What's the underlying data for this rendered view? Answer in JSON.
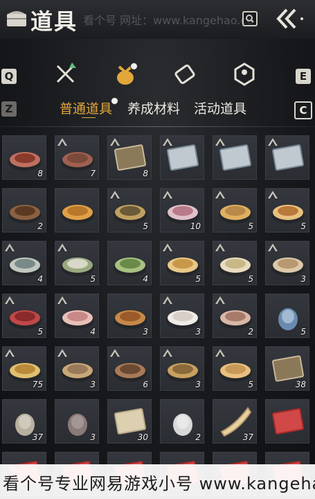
{
  "header": {
    "title": "道具",
    "watermark": "看个号 网址：www.kangehao.co",
    "icons": [
      "inventory-icon",
      "search-icon",
      "back-icon"
    ]
  },
  "keys": {
    "prev_tab": "Q",
    "next_tab": "E",
    "prev_subtab": "Z",
    "next_subtab": "C"
  },
  "category_tabs": [
    {
      "icon": "weapons-icon",
      "active": false,
      "badge": "up-arrow"
    },
    {
      "icon": "items-bag-icon",
      "active": true,
      "badge": "clock-dot"
    },
    {
      "icon": "scroll-icon",
      "active": false
    },
    {
      "icon": "gem-icon",
      "active": false
    }
  ],
  "subtabs": [
    {
      "label": "普通道具",
      "active": true
    },
    {
      "label": "养成材料",
      "active": false
    },
    {
      "label": "活动道具",
      "active": false
    }
  ],
  "items": [
    {
      "icon": "meat-icon",
      "qty": "8",
      "rank": false
    },
    {
      "icon": "sausage-plate-icon",
      "qty": "7",
      "rank": true
    },
    {
      "icon": "recipe-scroll-icon",
      "qty": "8",
      "rank": true
    },
    {
      "icon": "landscape-scroll-icon",
      "qty": "",
      "rank": true
    },
    {
      "icon": "landscape-scroll-icon",
      "qty": "",
      "rank": true
    },
    {
      "icon": "landscape-scroll-icon",
      "qty": "",
      "rank": true
    },
    {
      "icon": "eggs-icon",
      "qty": "2",
      "rank": false
    },
    {
      "icon": "buns-icon",
      "qty": "",
      "rank": false
    },
    {
      "icon": "mixed-dish-icon",
      "qty": "5",
      "rank": true
    },
    {
      "icon": "rice-dish-icon",
      "qty": "10",
      "rank": true
    },
    {
      "icon": "cake-icon",
      "qty": "5",
      "rank": true
    },
    {
      "icon": "soup-bowl-icon",
      "qty": "5",
      "rank": true
    },
    {
      "icon": "fish-soup-icon",
      "qty": "4",
      "rank": true
    },
    {
      "icon": "vegetable-soup-icon",
      "qty": "5",
      "rank": true
    },
    {
      "icon": "greens-plate-icon",
      "qty": "4",
      "rank": false
    },
    {
      "icon": "pancakes-icon",
      "qty": "5",
      "rank": true
    },
    {
      "icon": "noodle-bowl-icon",
      "qty": "5",
      "rank": true
    },
    {
      "icon": "porridge-bowl-icon",
      "qty": "3",
      "rank": true
    },
    {
      "icon": "braised-meat-icon",
      "qty": "5",
      "rank": true
    },
    {
      "icon": "sliced-meat-icon",
      "qty": "4",
      "rank": true
    },
    {
      "icon": "fried-chicken-icon",
      "qty": "3",
      "rank": false
    },
    {
      "icon": "dumplings-icon",
      "qty": "3",
      "rank": true
    },
    {
      "icon": "bean-soup-icon",
      "qty": "2",
      "rank": true
    },
    {
      "icon": "vase-icon",
      "qty": "5",
      "rank": false
    },
    {
      "icon": "fried-rice-icon",
      "qty": "75",
      "rank": true
    },
    {
      "icon": "seafood-plate-icon",
      "qty": "3",
      "rank": true
    },
    {
      "icon": "clay-pot-icon",
      "qty": "6",
      "rank": true
    },
    {
      "icon": "stew-bowl-icon",
      "qty": "3",
      "rank": true
    },
    {
      "icon": "pastry-icon",
      "qty": "5",
      "rank": true
    },
    {
      "icon": "letter-scroll-icon",
      "qty": "38",
      "rank": false
    },
    {
      "icon": "jar-icon",
      "qty": "37",
      "rank": false
    },
    {
      "icon": "pouch-icon",
      "qty": "3",
      "rank": false
    },
    {
      "icon": "paper-icon",
      "qty": "30",
      "rank": false
    },
    {
      "icon": "lantern-icon",
      "qty": "2",
      "rank": false
    },
    {
      "icon": "horn-icon",
      "qty": "37",
      "rank": false
    },
    {
      "icon": "red-envelope-icon",
      "qty": "",
      "rank": false
    },
    {
      "icon": "red-item-icon",
      "qty": "",
      "rank": false
    },
    {
      "icon": "red-item-icon",
      "qty": "",
      "rank": false
    },
    {
      "icon": "red-item-icon",
      "qty": "",
      "rank": false
    },
    {
      "icon": "red-item-icon",
      "qty": "",
      "rank": false
    },
    {
      "icon": "red-item-icon",
      "qty": "",
      "rank": false
    },
    {
      "icon": "red-item-icon",
      "qty": "",
      "rank": false
    }
  ],
  "footer": {
    "text": "看个号专业网易游戏小号 www.kangehao.co"
  },
  "colors": {
    "accent": "#e2a63a",
    "panel": "#2f3237",
    "background": "#15171b"
  }
}
